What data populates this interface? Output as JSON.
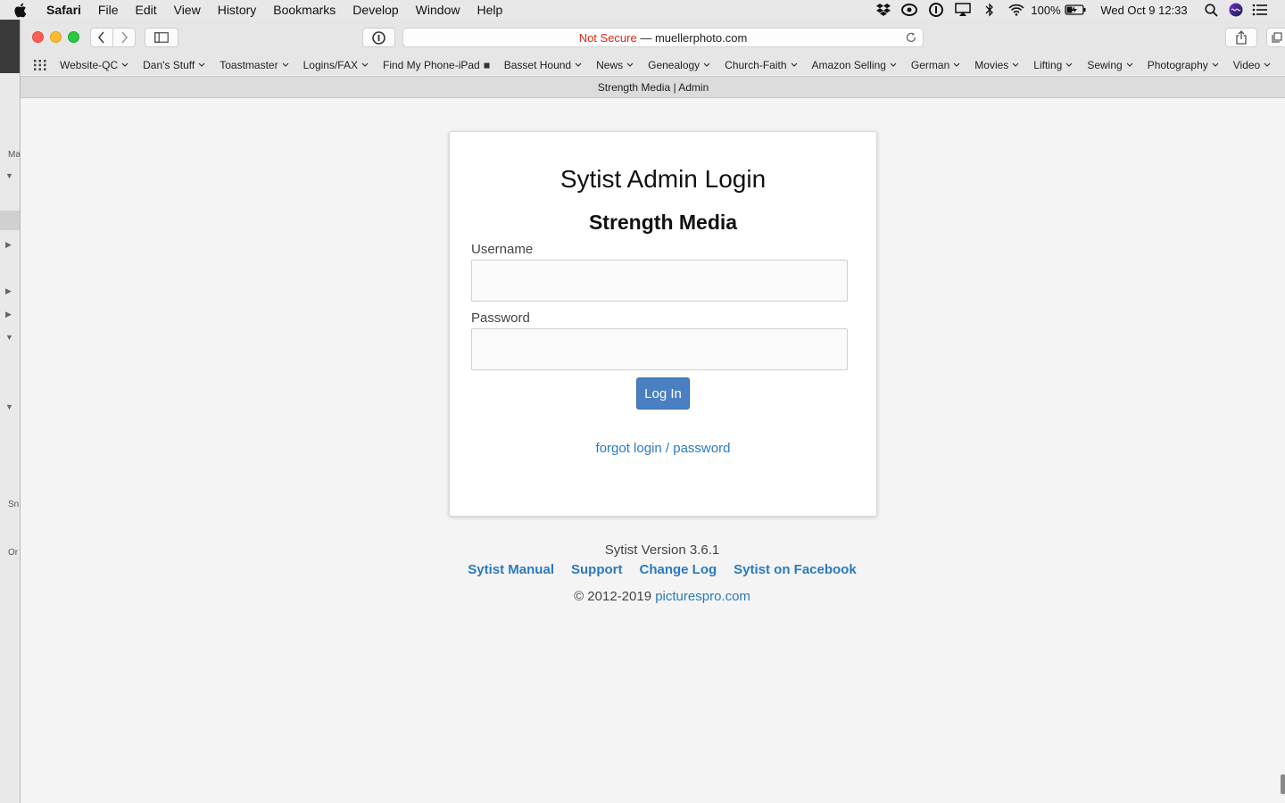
{
  "menubar": {
    "app_name": "Safari",
    "items": [
      "File",
      "Edit",
      "View",
      "History",
      "Bookmarks",
      "Develop",
      "Window",
      "Help"
    ],
    "battery": "100%",
    "datetime": "Wed Oct 9  12:33"
  },
  "sidebar_bg": {
    "labels": [
      "Ma",
      "Sn",
      "Or"
    ]
  },
  "toolbar": {
    "not_secure": "Not Secure",
    "separator": " — ",
    "domain": "muellerphoto.com"
  },
  "bookmarks": [
    "Website-QC",
    "Dan's Stuff",
    "Toastmaster",
    "Logins/FAX",
    "Find My Phone-iPad",
    "Basset Hound",
    "News",
    "Genealogy",
    "Church-Faith",
    "Amazon Selling",
    "German",
    "Movies",
    "Lifting",
    "Sewing",
    "Photography",
    "Video"
  ],
  "tab": {
    "title": "Strength Media | Admin"
  },
  "login": {
    "title": "Sytist Admin Login",
    "subtitle": "Strength Media",
    "username_label": "Username",
    "username_value": "",
    "password_label": "Password",
    "password_value": "",
    "login_button": "Log In",
    "forgot_link": "forgot login / password"
  },
  "footer": {
    "version": "Sytist Version 3.6.1",
    "links": [
      "Sytist Manual",
      "Support",
      "Change Log",
      "Sytist on Facebook"
    ],
    "copyright": "© 2012-2019",
    "copyright_link": "picturespro.com"
  },
  "colors": {
    "accent_link": "#2a7ac0",
    "button": "#4a7fc1",
    "not_secure": "#e0261b"
  }
}
